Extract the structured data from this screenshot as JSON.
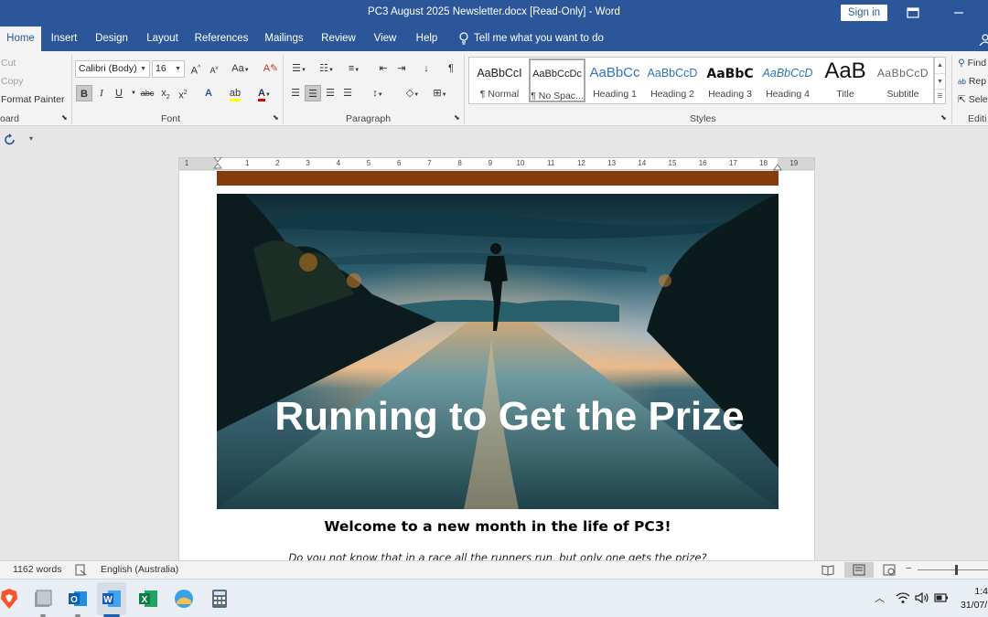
{
  "window": {
    "title": "PC3 August 2025 Newsletter.docx [Read-Only]  -  Word",
    "signin_label": "Sign in"
  },
  "tabs": [
    "Home",
    "Insert",
    "Design",
    "Layout",
    "References",
    "Mailings",
    "Review",
    "View",
    "Help"
  ],
  "tell_me": "Tell me what you want to do",
  "clipboard": {
    "cut": "Cut",
    "copy": "Copy",
    "format_painter": "Format Painter",
    "label": "oard"
  },
  "font": {
    "family": "Calibri (Body)",
    "size": "16",
    "label": "Font"
  },
  "paragraph": {
    "label": "Paragraph"
  },
  "styles": {
    "label": "Styles",
    "items": [
      {
        "preview": "AaBbCcI",
        "name": "¶ Normal"
      },
      {
        "preview": "AaBbCcDc",
        "name": "¶ No Spac..."
      },
      {
        "preview": "AaBbCc",
        "name": "Heading 1"
      },
      {
        "preview": "AaBbCcD",
        "name": "Heading 2"
      },
      {
        "preview": "AaBbC",
        "name": "Heading 3"
      },
      {
        "preview": "AaBbCcD",
        "name": "Heading 4"
      },
      {
        "preview": "AaB",
        "name": "Title"
      },
      {
        "preview": "AaBbCcD",
        "name": "Subtitle"
      }
    ]
  },
  "editing": {
    "find": "Find",
    "replace": "Rep",
    "select": "Sele",
    "label": "Editi"
  },
  "ruler": {
    "numbers": [
      "1",
      "1",
      "2",
      "3",
      "4",
      "5",
      "6",
      "7",
      "8",
      "9",
      "10",
      "11",
      "12",
      "13",
      "14",
      "15",
      "16",
      "17",
      "18",
      "19"
    ]
  },
  "document": {
    "hero_title": "Running to Get the Prize",
    "welcome": "Welcome to a new month in the life of PC3!",
    "verse": "Do you not know that in a race all the runners run, but only one gets the prize?"
  },
  "status": {
    "words": "1162 words",
    "language": "English (Australia)"
  },
  "taskbar": {
    "time": "1:4",
    "date": "31/07/"
  },
  "colors": {
    "word_blue": "#2b579a",
    "brown_bar": "#843c0c"
  }
}
